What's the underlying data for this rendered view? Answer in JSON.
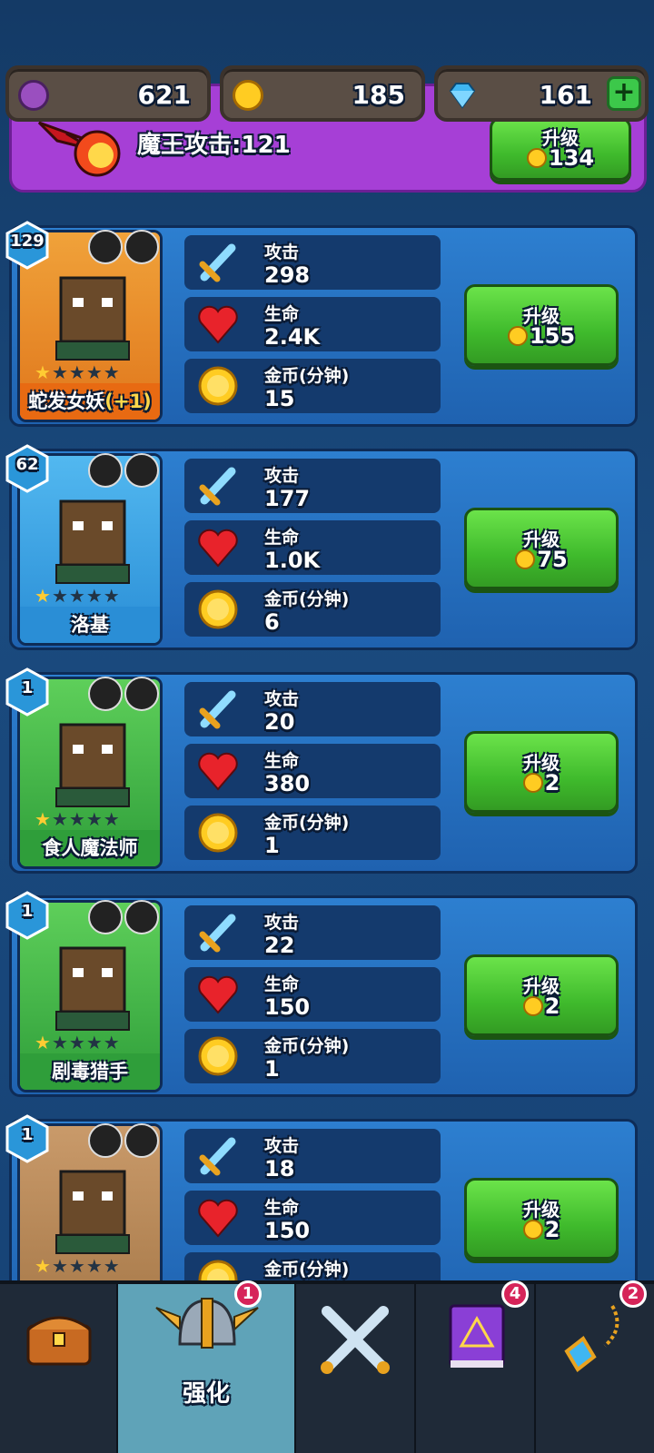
{
  "currency": {
    "purple": "621",
    "gold": "185",
    "gems": "161"
  },
  "boss": {
    "attack_text": "魔王攻击:121",
    "upgrade_label": "升级",
    "upgrade_cost": "134"
  },
  "stat_labels": {
    "attack": "攻击",
    "life": "生命",
    "gold": "金币(分钟)"
  },
  "upgrade_label": "升级",
  "heroes": [
    {
      "name": "蛇发女妖",
      "bonus": "(+1)",
      "level": "129",
      "attack": "298",
      "life": "2.4K",
      "gold": "15",
      "cost": "155",
      "stars": 1,
      "theme": "orange"
    },
    {
      "name": "洛基",
      "bonus": "",
      "level": "62",
      "attack": "177",
      "life": "1.0K",
      "gold": "6",
      "cost": "75",
      "stars": 1,
      "theme": "blue"
    },
    {
      "name": "食人魔法师",
      "bonus": "",
      "level": "1",
      "attack": "20",
      "life": "380",
      "gold": "1",
      "cost": "2",
      "stars": 1,
      "theme": "green"
    },
    {
      "name": "剧毒猎手",
      "bonus": "",
      "level": "1",
      "attack": "22",
      "life": "150",
      "gold": "1",
      "cost": "2",
      "stars": 1,
      "theme": "green"
    },
    {
      "name": "",
      "bonus": "",
      "level": "1",
      "attack": "18",
      "life": "150",
      "gold": "",
      "cost": "2",
      "stars": 1,
      "theme": "tan"
    }
  ],
  "nav": {
    "items": [
      {
        "icon": "chest-icon",
        "label": "",
        "badge": ""
      },
      {
        "icon": "helmet-icon",
        "label": "强化",
        "badge": "1"
      },
      {
        "icon": "swords-icon",
        "label": "",
        "badge": ""
      },
      {
        "icon": "spellbook-icon",
        "label": "",
        "badge": "4"
      },
      {
        "icon": "amulet-icon",
        "label": "",
        "badge": "2"
      }
    ]
  },
  "colors": {
    "background": "#1a4a7e",
    "card": "#2d7fd0",
    "button_green": "#3fba2c",
    "boss_purple": "#a63fd6",
    "nav_active": "#5fa3b8"
  }
}
